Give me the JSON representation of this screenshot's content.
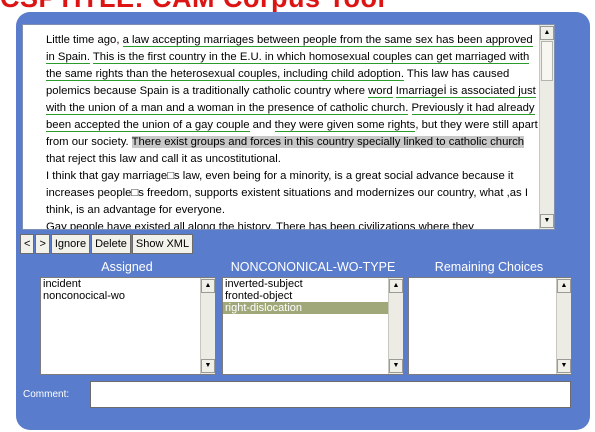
{
  "title": "CSPTITLE: CAM Corpus Tool",
  "document": {
    "paragraphs": [
      {
        "indent": true,
        "spans": [
          {
            "t": "Little time ago, ",
            "s": ""
          },
          {
            "t": "a law accepting marriages between people from the same sex has been approved in Spain.",
            "s": "ul"
          },
          {
            "t": " ",
            "s": ""
          },
          {
            "t": "This is the first country in the E.U. in which homosexual couples can get marriaged with the same rights than the heterosexual couples, including child adoption.",
            "s": "ul"
          },
          {
            "t": " This law has caused polemics because Spain is a traditionally catholic country where ",
            "s": ""
          },
          {
            "t": "word",
            "s": "ul"
          },
          {
            "t": " ",
            "s": ""
          },
          {
            "t": "Imarriageİ is associated just with the union of a man and a woman in the presence of catholic church.",
            "s": "ul"
          },
          {
            "t": " ",
            "s": ""
          },
          {
            "t": "Previously it had already been accepted the union of a gay couple",
            "s": "ul"
          },
          {
            "t": " and ",
            "s": ""
          },
          {
            "t": "they were given some rights",
            "s": "ul"
          },
          {
            "t": ", but they were still apart from our society. ",
            "s": ""
          },
          {
            "t": "There exist groups and forces in this country specially linked to catholic church",
            "s": "hl"
          },
          {
            "t": " that reject this law and call it as uncostitutional.",
            "s": ""
          }
        ]
      },
      {
        "indent": true,
        "spans": [
          {
            "t": "I think that gay marriage□s law, even being for a minority, is a great social advance because it increases people□s freedom, supports existent situations and modernizes our country, what ,as I think, is an advantage for everyone.",
            "s": ""
          }
        ]
      },
      {
        "indent": true,
        "spans": [
          {
            "t": "Gay people have existed all along the history. There has been civilizations where they",
            "s": ""
          }
        ]
      }
    ]
  },
  "buttons": {
    "prev": "<",
    "next": ">",
    "ignore": "Ignore",
    "delete": "Delete",
    "show_xml": "Show XML"
  },
  "columns": {
    "assigned": {
      "title": "Assigned",
      "items": [
        {
          "label": "incident",
          "selected": false
        },
        {
          "label": "nonconocical-wo",
          "selected": false
        }
      ]
    },
    "nonconocical": {
      "title": "NONCONONICAL-WO-TYPE",
      "items": [
        {
          "label": "inverted-subject",
          "selected": false
        },
        {
          "label": "fronted-object",
          "selected": false
        },
        {
          "label": "right-dislocation",
          "selected": true
        }
      ]
    },
    "remaining": {
      "title": "Remaining Choices",
      "items": []
    }
  },
  "comment": {
    "label": "Comment:",
    "value": ""
  },
  "icons": {
    "scroll_up": "triangle-up",
    "scroll_down": "triangle-down"
  },
  "colors": {
    "title": "#dd1414",
    "panel": "#5a7ccc",
    "selection": "#a0a779",
    "annotation_underline": "#2c9b2c",
    "highlight": "#c8c8c8"
  }
}
